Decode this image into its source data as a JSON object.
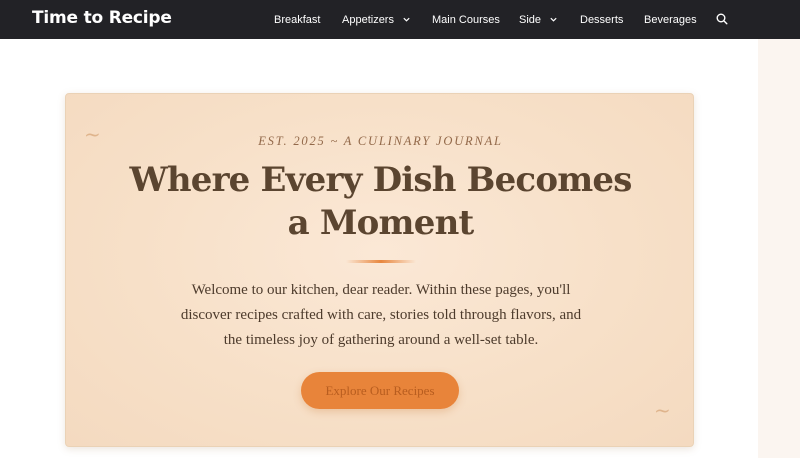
{
  "site": {
    "title": "Time to Recipe"
  },
  "nav": {
    "items": [
      {
        "label": "Breakfast",
        "has_dropdown": false
      },
      {
        "label": "Appetizers",
        "has_dropdown": true
      },
      {
        "label": "Main Courses",
        "has_dropdown": false
      },
      {
        "label": "Side",
        "has_dropdown": true
      },
      {
        "label": "Desserts",
        "has_dropdown": false
      },
      {
        "label": "Beverages",
        "has_dropdown": false
      }
    ],
    "search_icon": "search-icon"
  },
  "hero": {
    "eyebrow": "EST. 2025 ~ A CULINARY JOURNAL",
    "title_line1": "Where Every Dish Becomes",
    "title_line2": "a Moment",
    "description_line1": "Welcome to our kitchen, dear reader. Within these pages, you'll",
    "description_line2": "discover recipes crafted with care, stories told through flavors, and",
    "description_line3": "the timeless joy of gathering around a well-set table.",
    "cta_label": "Explore Our Recipes",
    "flourish": "~"
  },
  "colors": {
    "nav_bg": "#222226",
    "hero_bg": "#f7e0c8",
    "accent": "#e8843a",
    "title": "#5b4530",
    "text": "#4d3b2c"
  }
}
